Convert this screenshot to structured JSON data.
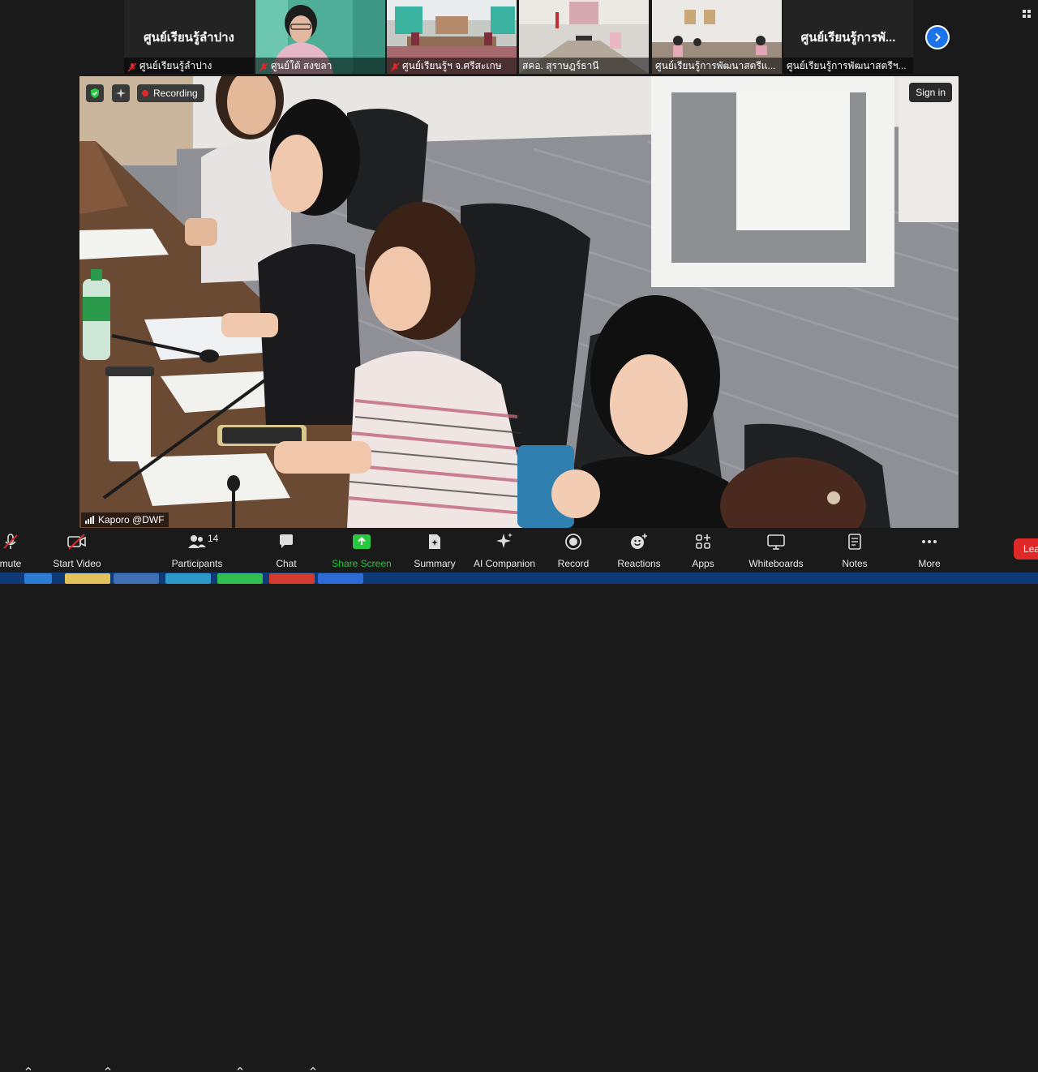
{
  "strip": {
    "tiles": [
      {
        "big_name": "ศูนย์เรียนรู้ลำปาง",
        "caption": "ศูนย์เรียนรู้ลำปาง",
        "muted": true
      },
      {
        "big_name": "",
        "caption": "ศูนย์ใต้ สงขลา",
        "muted": true
      },
      {
        "big_name": "",
        "caption": "ศูนย์เรียนรู้ฯ จ.ศรีสะเกษ",
        "muted": true
      },
      {
        "big_name": "",
        "caption": "สคอ. สุราษฎร์ธานี",
        "muted": false
      },
      {
        "big_name": "",
        "caption": "ศูนย์เรียนรู้การพัฒนาสตรีแ...",
        "muted": false
      },
      {
        "big_name": "ศูนย์เรียนรู้การพั...",
        "caption": "ศูนย์เรียนรู้การพัฒนาสตรีฯ...",
        "muted": false
      }
    ],
    "next_icon": "chevron-right-icon"
  },
  "video": {
    "recording_label": "Recording",
    "sign_in_label": "Sign in",
    "speaker_name": "Kaporo @DWF"
  },
  "toolbar": {
    "items": [
      {
        "label": "mute",
        "icon": "mic-off-icon"
      },
      {
        "label": "Start Video",
        "icon": "video-off-icon"
      },
      {
        "label": "Participants",
        "icon": "participants-icon",
        "count": "14"
      },
      {
        "label": "Chat",
        "icon": "chat-icon"
      },
      {
        "label": "Share Screen",
        "icon": "share-screen-icon"
      },
      {
        "label": "Summary",
        "icon": "summary-icon"
      },
      {
        "label": "AI Companion",
        "icon": "ai-companion-icon"
      },
      {
        "label": "Record",
        "icon": "record-icon"
      },
      {
        "label": "Reactions",
        "icon": "reactions-icon"
      },
      {
        "label": "Apps",
        "icon": "apps-icon"
      },
      {
        "label": "Whiteboards",
        "icon": "whiteboard-icon"
      },
      {
        "label": "Notes",
        "icon": "notes-icon"
      },
      {
        "label": "More",
        "icon": "more-icon"
      }
    ],
    "leave_label": "Lea"
  },
  "colors": {
    "share_green": "#28c840",
    "leave_red": "#e02828",
    "record_red": "#e02828",
    "strip_arrow_blue": "#1a73e8",
    "taskbar_blue": "#0f3a78"
  }
}
